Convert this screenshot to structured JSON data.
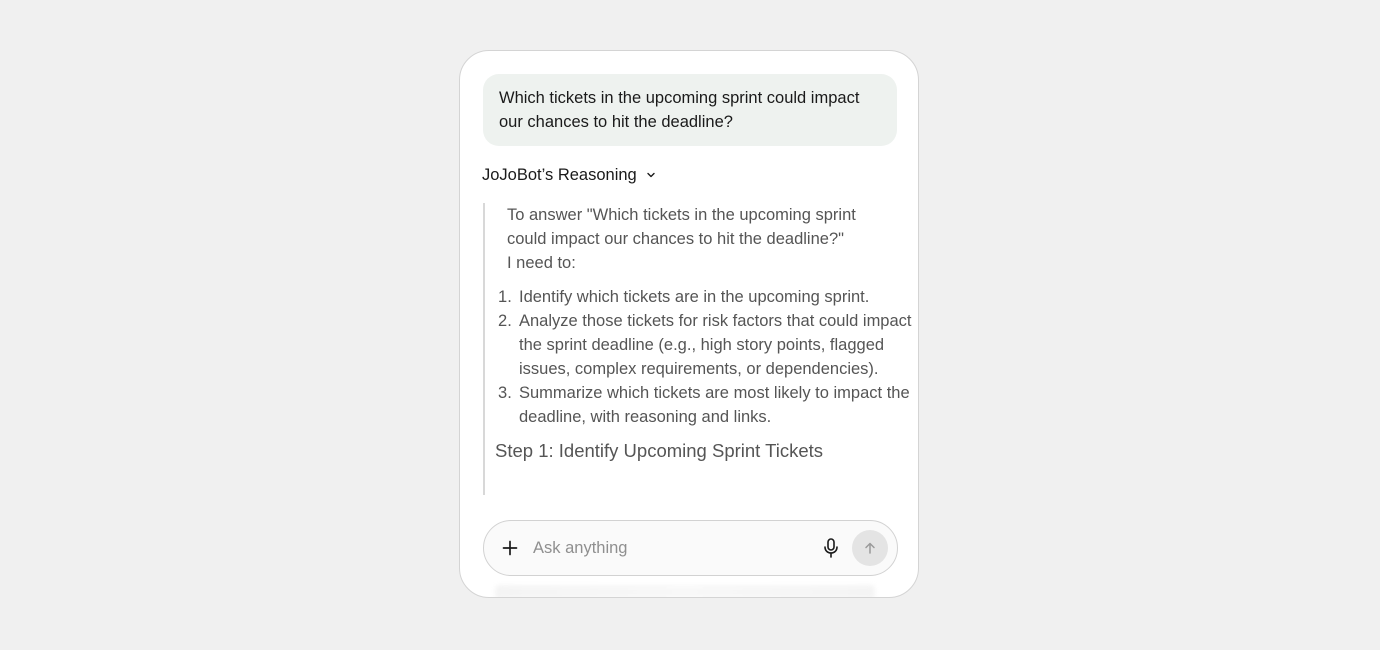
{
  "conversation": {
    "user_message": "Which tickets in the upcoming sprint could impact our chances to hit the deadline?"
  },
  "reasoning": {
    "toggle_label": "JoJoBot’s Reasoning",
    "intro_line1": "To answer \"Which tickets in the upcoming sprint could impact our chances to hit the deadline?\"",
    "intro_line2": "I need to:",
    "steps": [
      "Identify which tickets are in the upcoming sprint.",
      "Analyze those tickets for risk factors that could impact the sprint deadline (e.g., high story points, flagged issues, complex requirements, or dependencies).",
      "Summarize which tickets are most likely to impact the deadline, with reasoning and links."
    ],
    "step_heading": "Step 1: Identify Upcoming Sprint Tickets"
  },
  "composer": {
    "placeholder": "Ask anything",
    "value": "",
    "icons": {
      "add": "plus-icon",
      "voice": "microphone-icon",
      "send": "arrow-up-icon"
    }
  },
  "colors": {
    "page_background": "#f0f0f0",
    "card_background": "#ffffff",
    "user_bubble": "#eef2ef",
    "reasoning_text": "#555555",
    "send_button": "#e4e4e4"
  }
}
